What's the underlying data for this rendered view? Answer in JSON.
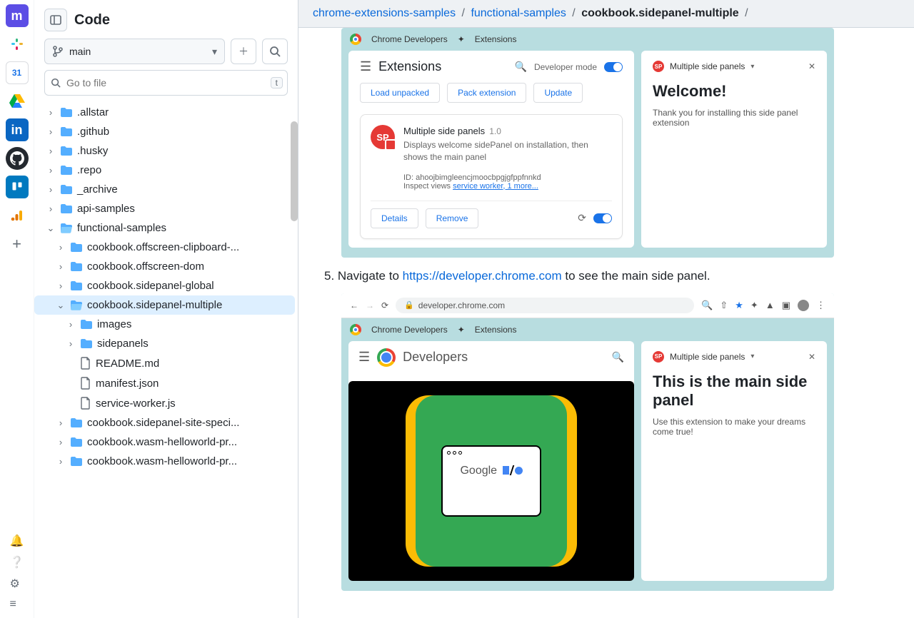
{
  "rail": {
    "calendar_day": "31"
  },
  "sidebar": {
    "title": "Code",
    "branch": "main",
    "filter_placeholder": "Go to file",
    "kbd_hint": "t",
    "tree": [
      {
        "type": "folder",
        "label": ".allstar",
        "depth": 0,
        "open": false
      },
      {
        "type": "folder",
        "label": ".github",
        "depth": 0,
        "open": false
      },
      {
        "type": "folder",
        "label": ".husky",
        "depth": 0,
        "open": false
      },
      {
        "type": "folder",
        "label": ".repo",
        "depth": 0,
        "open": false
      },
      {
        "type": "folder",
        "label": "_archive",
        "depth": 0,
        "open": false
      },
      {
        "type": "folder",
        "label": "api-samples",
        "depth": 0,
        "open": false
      },
      {
        "type": "folder",
        "label": "functional-samples",
        "depth": 0,
        "open": true
      },
      {
        "type": "folder",
        "label": "cookbook.offscreen-clipboard-...",
        "depth": 1,
        "open": false
      },
      {
        "type": "folder",
        "label": "cookbook.offscreen-dom",
        "depth": 1,
        "open": false
      },
      {
        "type": "folder",
        "label": "cookbook.sidepanel-global",
        "depth": 1,
        "open": false
      },
      {
        "type": "folder",
        "label": "cookbook.sidepanel-multiple",
        "depth": 1,
        "open": true,
        "selected": true
      },
      {
        "type": "folder",
        "label": "images",
        "depth": 2,
        "open": false
      },
      {
        "type": "folder",
        "label": "sidepanels",
        "depth": 2,
        "open": false
      },
      {
        "type": "file",
        "label": "README.md",
        "depth": 2
      },
      {
        "type": "file",
        "label": "manifest.json",
        "depth": 2
      },
      {
        "type": "file",
        "label": "service-worker.js",
        "depth": 2
      },
      {
        "type": "folder",
        "label": "cookbook.sidepanel-site-speci...",
        "depth": 1,
        "open": false
      },
      {
        "type": "folder",
        "label": "cookbook.wasm-helloworld-pr...",
        "depth": 1,
        "open": false
      },
      {
        "type": "folder",
        "label": "cookbook.wasm-helloworld-pr...",
        "depth": 1,
        "open": false
      }
    ]
  },
  "breadcrumb": {
    "parts": [
      "chrome-extensions-samples",
      "functional-samples",
      "cookbook.sidepanel-multiple"
    ]
  },
  "content": {
    "step5_prefix": "5. Navigate to ",
    "step5_link": "https://developer.chrome.com",
    "step5_suffix": " to see the main side panel.",
    "mock1": {
      "tab1": "Chrome Developers",
      "tab2": "Extensions",
      "ext_title": "Extensions",
      "dev_mode": "Developer mode",
      "btn1": "Load unpacked",
      "btn2": "Pack extension",
      "btn3": "Update",
      "card_name": "Multiple side panels",
      "card_ver": "1.0",
      "card_desc": "Displays welcome sidePanel on installation, then shows the main panel",
      "card_id": "ID: ahoojbimgleencjmoocbpgjgfppfnnkd",
      "card_inspect": "Inspect views ",
      "card_inspect_link": "service worker, 1 more...",
      "details": "Details",
      "remove": "Remove",
      "panel_title": "Multiple side panels",
      "panel_h1": "Welcome!",
      "panel_p": "Thank you for installing this side panel extension"
    },
    "mock2": {
      "url": "developer.chrome.com",
      "tab1": "Chrome Developers",
      "tab2": "Extensions",
      "dev_title": "Developers",
      "io_text": "Google",
      "panel_title": "Multiple side panels",
      "panel_h1": "This is the main side panel",
      "panel_p": "Use this extension to make your dreams come true!"
    }
  }
}
